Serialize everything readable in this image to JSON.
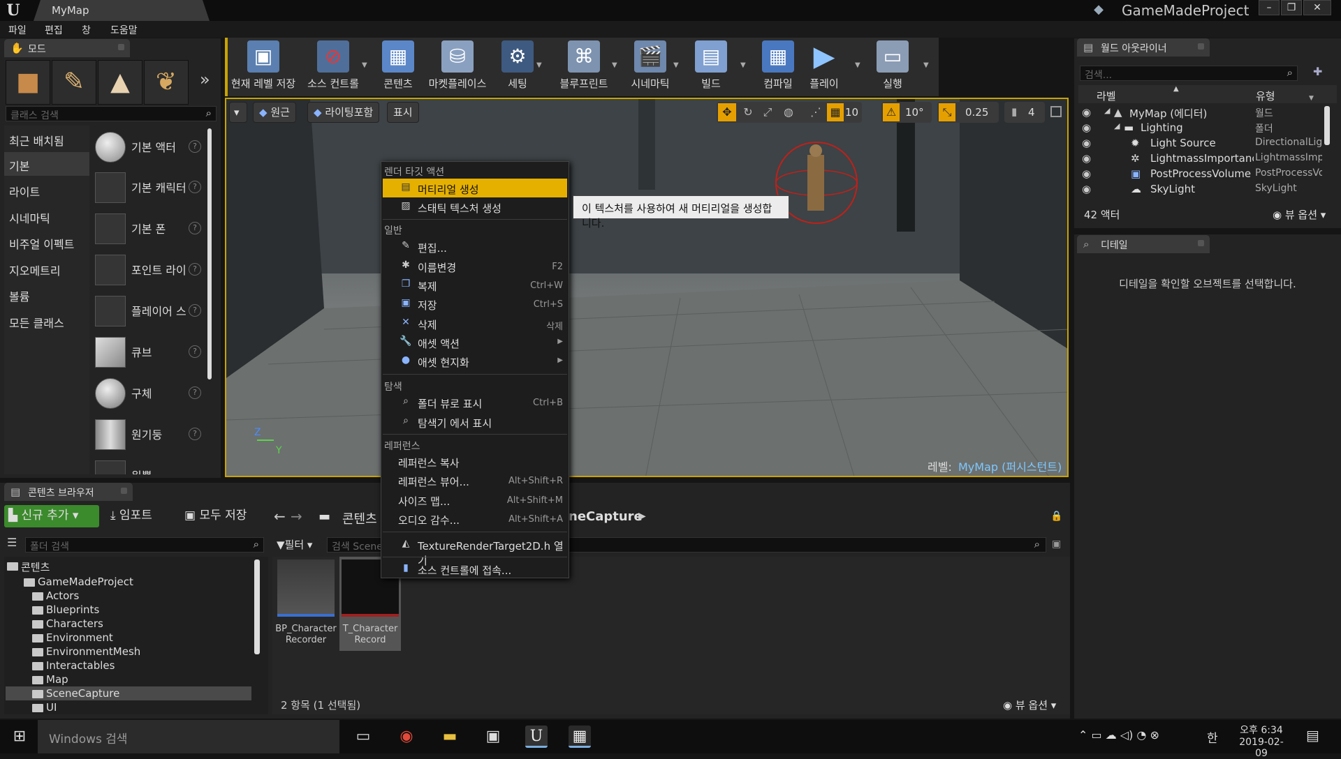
{
  "window": {
    "level_tab": "MyMap",
    "project_title": "GameMadeProject",
    "buttons": [
      "–",
      "❐",
      "✕"
    ]
  },
  "menubar": [
    "파일",
    "편집",
    "창",
    "도움말"
  ],
  "modes_panel": {
    "tab_label": "모드",
    "search_placeholder": "클래스 검색",
    "categories": [
      "최근 배치됨",
      "기본",
      "라이트",
      "시네마틱",
      "비주얼 이펙트",
      "지오메트리",
      "볼륨",
      "모든 클래스"
    ],
    "selected_category": "기본",
    "items": [
      "기본 액터",
      "기본 캐릭터",
      "기본 폰",
      "포인트 라이트",
      "플레이어 스타트",
      "큐브",
      "구체",
      "원기둥",
      "원뿔"
    ],
    "help_glyph": "?"
  },
  "toolbar": {
    "buttons": [
      {
        "label": "현재 레벨 저장",
        "icon": "save-icon"
      },
      {
        "label": "소스 컨트롤",
        "icon": "source-control-icon"
      },
      {
        "label": "콘텐츠",
        "icon": "content-icon"
      },
      {
        "label": "마켓플레이스",
        "icon": "marketplace-icon"
      },
      {
        "label": "세팅",
        "icon": "settings-icon"
      },
      {
        "label": "블루프린트",
        "icon": "blueprint-icon"
      },
      {
        "label": "시네마틱",
        "icon": "cinematics-icon"
      },
      {
        "label": "빌드",
        "icon": "build-icon"
      },
      {
        "label": "컴파일",
        "icon": "compile-icon"
      },
      {
        "label": "플레이",
        "icon": "play-icon"
      },
      {
        "label": "실행",
        "icon": "launch-icon"
      }
    ]
  },
  "viewport": {
    "perspective": "원근",
    "lighting": "라이팅포함",
    "show": "표시",
    "grid_snap": "10",
    "rot_snap": "10°",
    "scale_snap": "0.25",
    "camera_speed": "4",
    "level_label": "레벨:",
    "level_name": "MyMap (퍼시스턴트)",
    "axis_z": "Z",
    "axis_y": "Y"
  },
  "context_menu": {
    "section_render": "렌더 타깃 액션",
    "item_create_material": "머티리얼 생성",
    "item_create_static": "스태틱 텍스처 생성",
    "section_common": "일반",
    "item_edit": "편집...",
    "item_rename": "이름변경",
    "sc_rename": "F2",
    "item_duplicate": "복제",
    "sc_duplicate": "Ctrl+W",
    "item_save": "저장",
    "sc_save": "Ctrl+S",
    "item_delete": "삭제",
    "sc_delete": "삭제",
    "item_asset_actions": "애셋 액션",
    "item_asset_localize": "애셋 현지화",
    "section_explore": "탐색",
    "item_show_folder": "폴더 뷰로 표시",
    "sc_show_folder": "Ctrl+B",
    "item_show_explorer": "탐색기 에서 표시",
    "section_refs": "레퍼런스",
    "item_copy_ref": "레퍼런스 복사",
    "item_ref_viewer": "레퍼런스 뷰어...",
    "sc_ref_viewer": "Alt+Shift+R",
    "item_size_map": "사이즈 맵...",
    "sc_size_map": "Alt+Shift+M",
    "item_audit": "오디오 감수...",
    "sc_audit": "Alt+Shift+A",
    "item_open_header": "TextureRenderTarget2D.h 열기",
    "item_connect_sc": "소스 컨트롤에 접속...",
    "arrow": "▶"
  },
  "tooltip": "이 텍스처를 사용하여 새 머티리얼을 생성합니다.",
  "outliner": {
    "tab_label": "월드 아웃라이너",
    "search_placeholder": "검색...",
    "col_label": "라벨",
    "col_type": "유형",
    "rows": [
      {
        "label": "MyMap (에디터)",
        "type": "월드"
      },
      {
        "label": "Lighting",
        "type": "폴더"
      },
      {
        "label": "Light Source",
        "type": "DirectionalLight"
      },
      {
        "label": "LightmassImportanceVolume",
        "type": "LightmassImportanceVolume"
      },
      {
        "label": "PostProcessVolume",
        "type": "PostProcessVolume"
      },
      {
        "label": "SkyLight",
        "type": "SkyLight"
      }
    ],
    "actor_count": "42 액터",
    "view_options": "뷰 옵션"
  },
  "details": {
    "tab_label": "디테일",
    "empty_message": "디테일을 확인할 오브젝트를 선택합니다."
  },
  "content_browser": {
    "tab_label": "콘텐츠 브라우저",
    "add_new": "신규 추가",
    "import": "임포트",
    "save_all": "모두 저장",
    "path_root": "콘텐츠",
    "path_tail": "neCapture",
    "folder_search_placeholder": "폴더 검색",
    "filter": "필터",
    "asset_search_placeholder": "검색 Scene",
    "tree": [
      "콘텐츠",
      "GameMadeProject",
      "Actors",
      "Blueprints",
      "Characters",
      "Environment",
      "EnvironmentMesh",
      "Interactables",
      "Map",
      "SceneCapture",
      "UI"
    ],
    "assets": [
      {
        "name_line1": "BP_Character",
        "name_line2": "Recorder"
      },
      {
        "name_line1": "T_Character",
        "name_line2": "Record"
      }
    ],
    "status": "2 항목 (1 선택됨)",
    "view_options": "뷰 옵션"
  },
  "taskbar": {
    "search_placeholder": "Windows 검색",
    "ime": "한",
    "time": "오후 6:34",
    "date": "2019-02-09"
  }
}
